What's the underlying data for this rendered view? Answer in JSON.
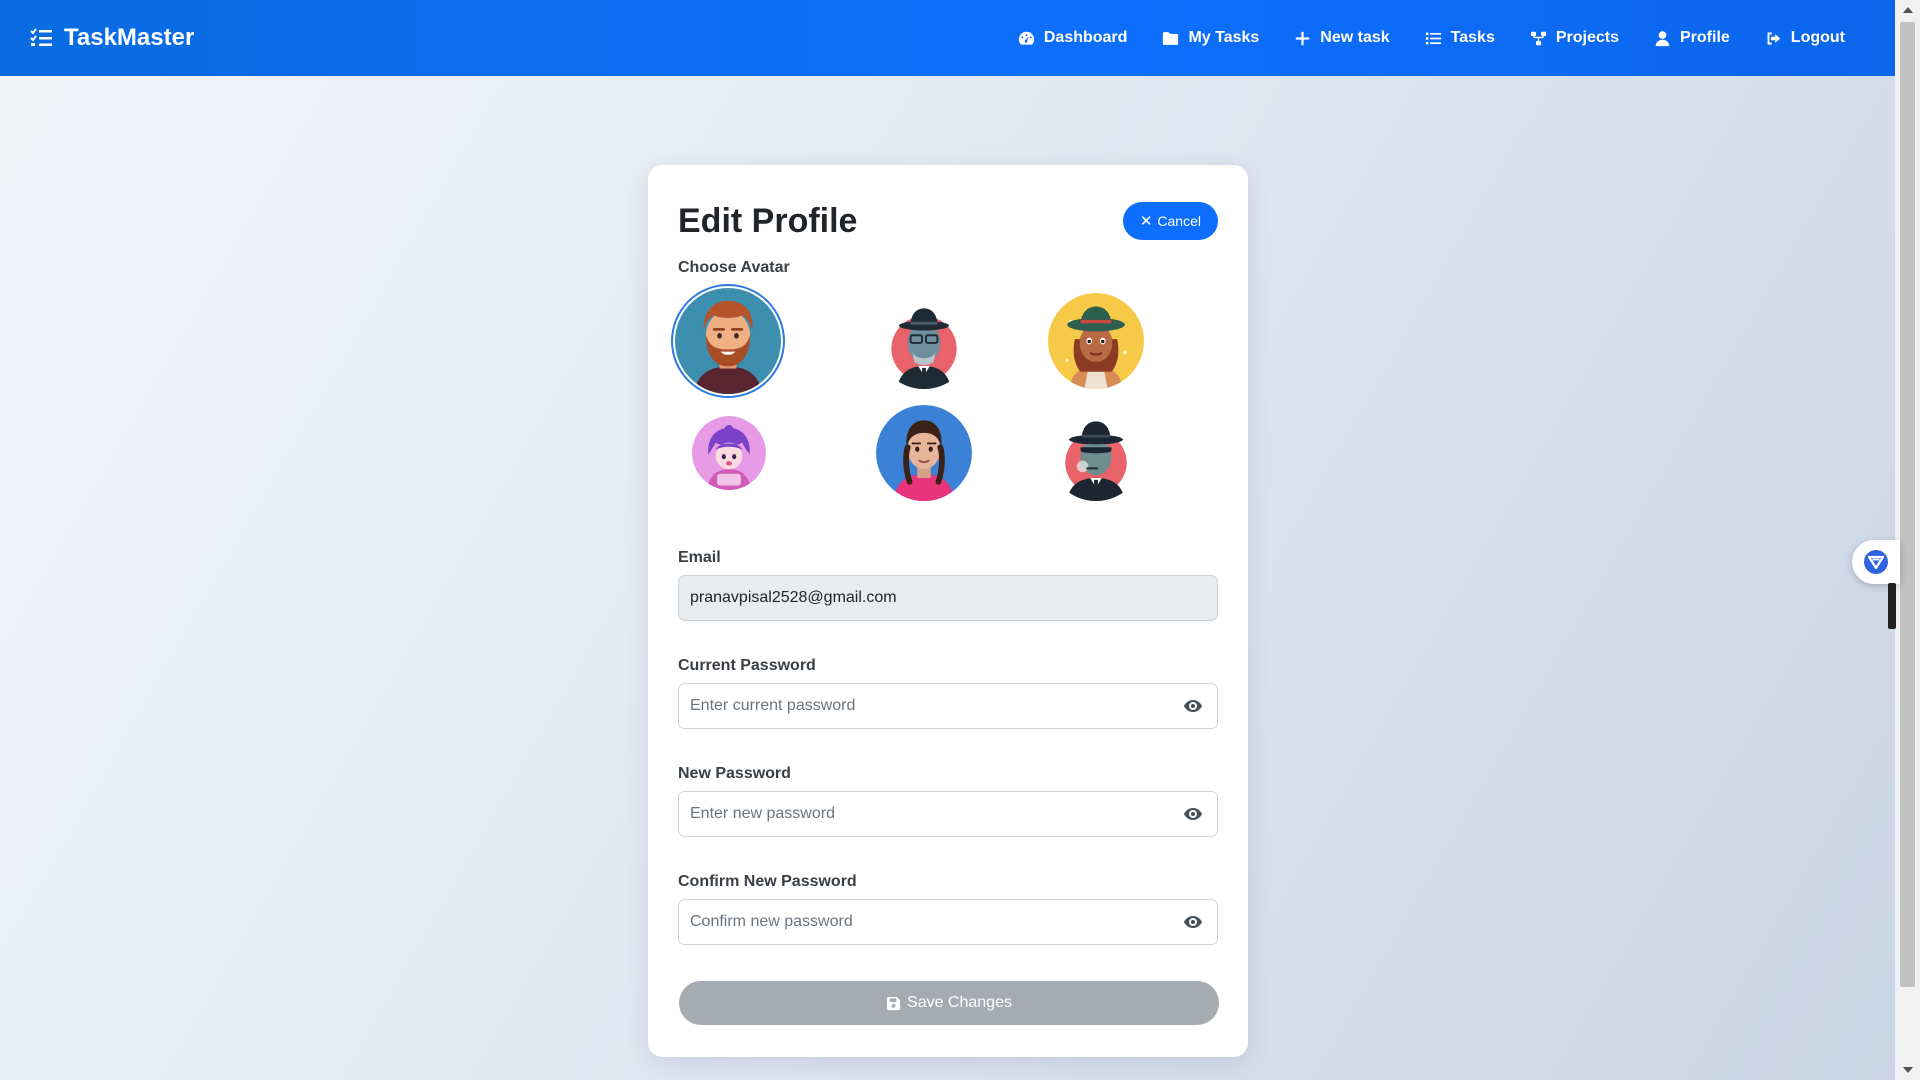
{
  "brand": {
    "name": "TaskMaster",
    "icon": "list-check-icon"
  },
  "nav": {
    "items": [
      {
        "label": "Dashboard",
        "icon": "gauge-icon"
      },
      {
        "label": "My Tasks",
        "icon": "folder-icon"
      },
      {
        "label": "New task",
        "icon": "plus-icon"
      },
      {
        "label": "Tasks",
        "icon": "list-icon"
      },
      {
        "label": "Projects",
        "icon": "diagram-icon"
      },
      {
        "label": "Profile",
        "icon": "user-icon"
      },
      {
        "label": "Logout",
        "icon": "sign-out-icon"
      }
    ]
  },
  "form": {
    "title": "Edit Profile",
    "cancel_label": "Cancel",
    "avatar_label": "Choose Avatar",
    "avatars": [
      {
        "name": "bearded-man",
        "selected": true
      },
      {
        "name": "detective-glasses",
        "selected": false
      },
      {
        "name": "cowgirl",
        "selected": false
      },
      {
        "name": "purple-girl",
        "selected": false
      },
      {
        "name": "braided-girl",
        "selected": false
      },
      {
        "name": "smoking-detective",
        "selected": false
      }
    ],
    "email": {
      "label": "Email",
      "value": "pranavpisal2528@gmail.com"
    },
    "current_password": {
      "label": "Current Password",
      "placeholder": "Enter current password"
    },
    "new_password": {
      "label": "New Password",
      "placeholder": "Enter new password"
    },
    "confirm_password": {
      "label": "Confirm New Password",
      "placeholder": "Confirm new password"
    },
    "save_label": "Save Changes"
  },
  "colors": {
    "primary": "#0d6efd",
    "save_disabled": "#a6abb2",
    "text": "#212529"
  }
}
